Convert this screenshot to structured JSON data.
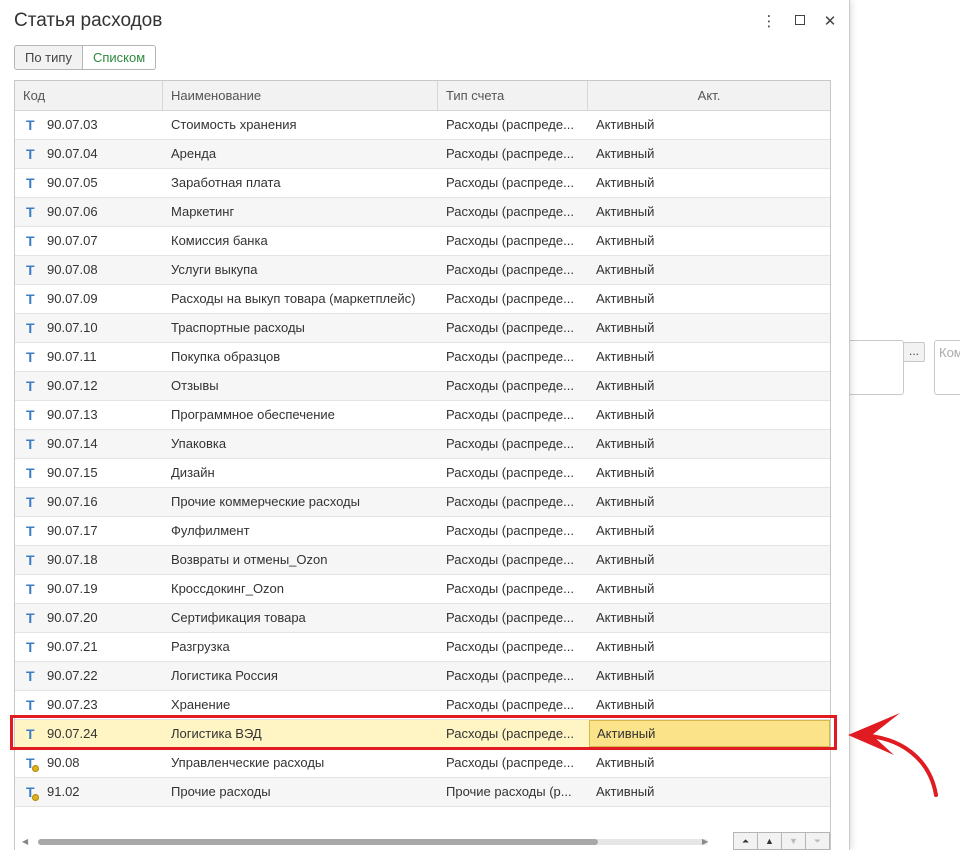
{
  "window": {
    "title": "Статья расходов",
    "controls": {
      "more_icon": "more-vertical-icon",
      "maximize_icon": "maximize-icon",
      "close_icon": "close-icon"
    }
  },
  "view_switch": {
    "by_type": "По типу",
    "list": "Списком",
    "active": "Списком"
  },
  "table": {
    "columns": [
      "Код",
      "Наименование",
      "Тип счета",
      "Акт."
    ],
    "rows": [
      {
        "code": "90.07.03",
        "name": "Стоимость хранения",
        "type": "Расходы (распреде...",
        "act": "Активный"
      },
      {
        "code": "90.07.04",
        "name": "Аренда",
        "type": "Расходы (распреде...",
        "act": "Активный"
      },
      {
        "code": "90.07.05",
        "name": "Заработная плата",
        "type": "Расходы (распреде...",
        "act": "Активный"
      },
      {
        "code": "90.07.06",
        "name": "Маркетинг",
        "type": "Расходы (распреде...",
        "act": "Активный"
      },
      {
        "code": "90.07.07",
        "name": "Комиссия банка",
        "type": "Расходы (распреде...",
        "act": "Активный"
      },
      {
        "code": "90.07.08",
        "name": "Услуги выкупа",
        "type": "Расходы (распреде...",
        "act": "Активный"
      },
      {
        "code": "90.07.09",
        "name": "Расходы на выкуп товара (маркетплейс)",
        "type": "Расходы (распреде...",
        "act": "Активный"
      },
      {
        "code": "90.07.10",
        "name": "Траспортные расходы",
        "type": "Расходы (распреде...",
        "act": "Активный"
      },
      {
        "code": "90.07.11",
        "name": "Покупка образцов",
        "type": "Расходы (распреде...",
        "act": "Активный"
      },
      {
        "code": "90.07.12",
        "name": "Отзывы",
        "type": "Расходы (распреде...",
        "act": "Активный"
      },
      {
        "code": "90.07.13",
        "name": "Программное обеспечение",
        "type": "Расходы (распреде...",
        "act": "Активный"
      },
      {
        "code": "90.07.14",
        "name": "Упаковка",
        "type": "Расходы (распреде...",
        "act": "Активный"
      },
      {
        "code": "90.07.15",
        "name": "Дизайн",
        "type": "Расходы (распреде...",
        "act": "Активный"
      },
      {
        "code": "90.07.16",
        "name": "Прочие коммерческие расходы",
        "type": "Расходы (распреде...",
        "act": "Активный"
      },
      {
        "code": "90.07.17",
        "name": "Фулфилмент",
        "type": "Расходы (распреде...",
        "act": "Активный"
      },
      {
        "code": "90.07.18",
        "name": "Возвраты и отмены_Ozon",
        "type": "Расходы (распреде...",
        "act": "Активный"
      },
      {
        "code": "90.07.19",
        "name": "Кроссдокинг_Ozon",
        "type": "Расходы (распреде...",
        "act": "Активный"
      },
      {
        "code": "90.07.20",
        "name": "Сертификация товара",
        "type": "Расходы (распреде...",
        "act": "Активный"
      },
      {
        "code": "90.07.21",
        "name": "Разгрузка",
        "type": "Расходы (распреде...",
        "act": "Активный"
      },
      {
        "code": "90.07.22",
        "name": "Логистика Россия",
        "type": "Расходы (распреде...",
        "act": "Активный"
      },
      {
        "code": "90.07.23",
        "name": "Хранение",
        "type": "Расходы (распреде...",
        "act": "Активный"
      },
      {
        "code": "90.07.24",
        "name": "Логистика ВЭД",
        "type": "Расходы (распреде...",
        "act": "Активный",
        "selected": true
      },
      {
        "code": "90.08",
        "name": "Управленческие расходы",
        "type": "Расходы (распреде...",
        "act": "Активный",
        "group": true
      },
      {
        "code": "91.02",
        "name": "Прочие расходы",
        "type": "Прочие расходы (р...",
        "act": "Активный",
        "group": true
      }
    ]
  },
  "background": {
    "field_placeholder": "Ком",
    "select_button": "..."
  },
  "colors": {
    "highlight": "#e01b22",
    "selected_row": "#fff4c4",
    "active_switch": "#2d8a3e",
    "icon": "#3b7dc4"
  }
}
